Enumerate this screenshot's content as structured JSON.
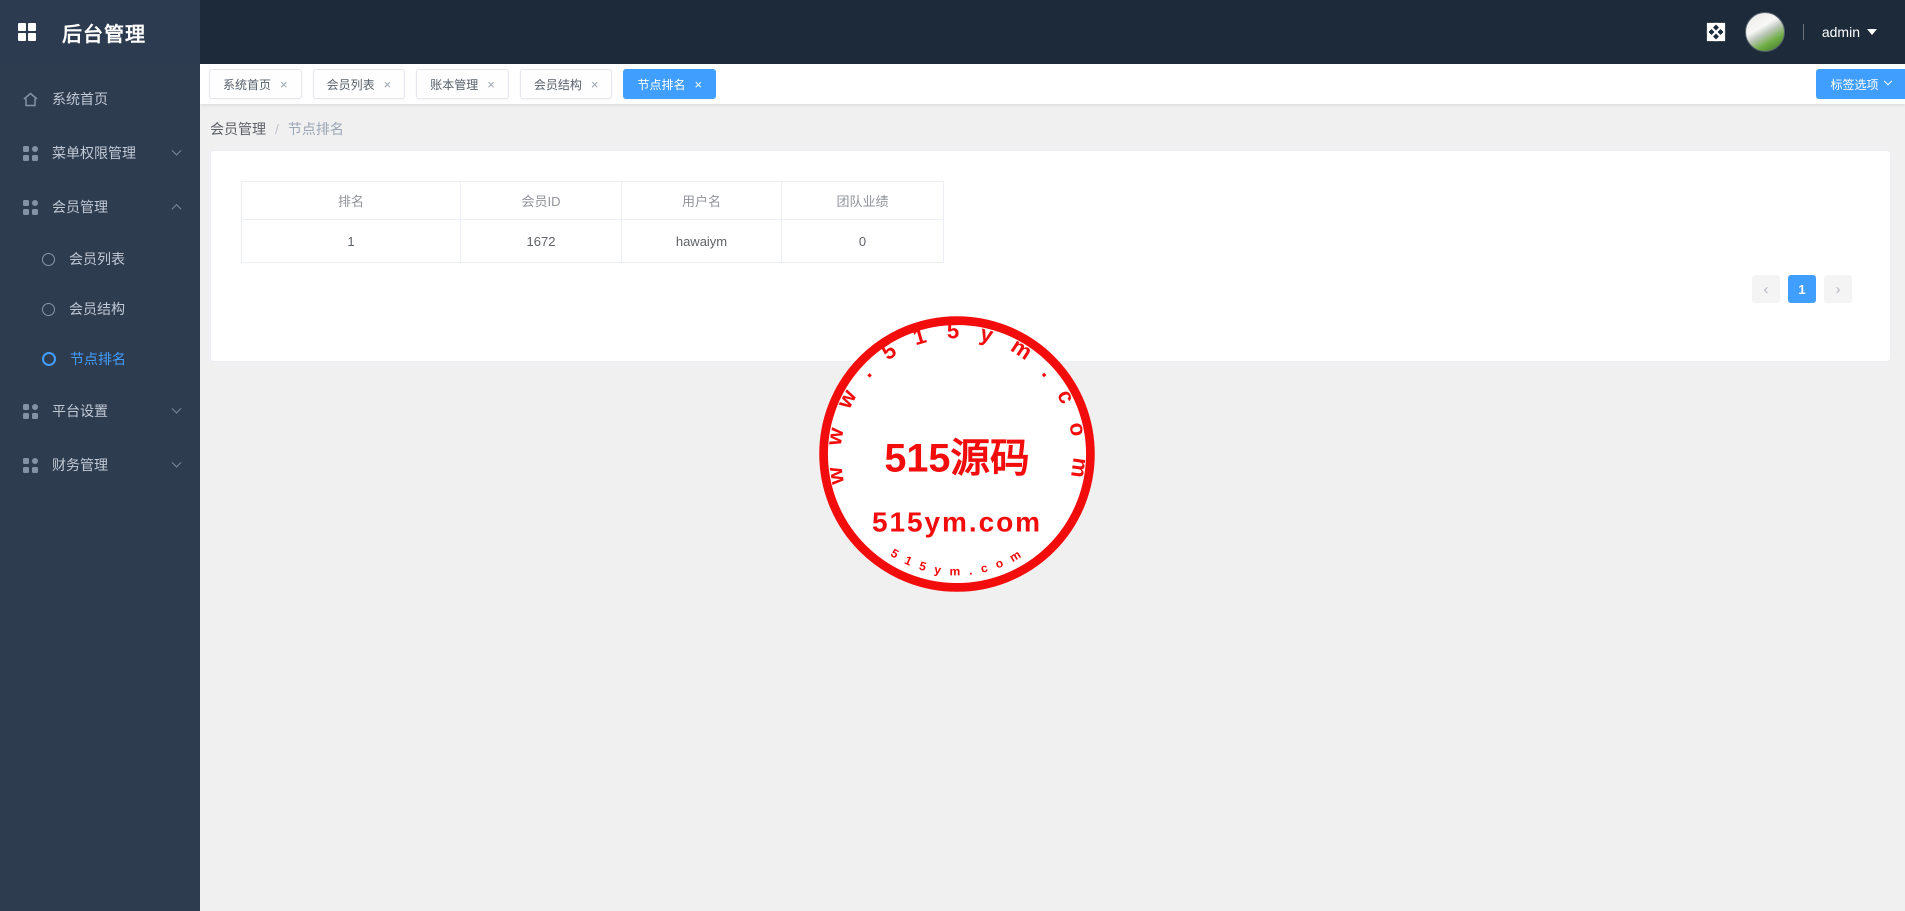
{
  "header": {
    "logo_title": "后台管理",
    "username": "admin"
  },
  "sidebar": {
    "items": [
      {
        "label": "系统首页",
        "icon": "home-icon"
      },
      {
        "label": "菜单权限管理",
        "icon": "grid-icon",
        "chevron": "down"
      },
      {
        "label": "会员管理",
        "icon": "grid-icon",
        "chevron": "up",
        "expanded": true,
        "children": [
          {
            "label": "会员列表",
            "active": false
          },
          {
            "label": "会员结构",
            "active": false
          },
          {
            "label": "节点排名",
            "active": true
          }
        ]
      },
      {
        "label": "平台设置",
        "icon": "grid-icon",
        "chevron": "down"
      },
      {
        "label": "财务管理",
        "icon": "grid-icon",
        "chevron": "down"
      }
    ]
  },
  "tabs": {
    "close_glyph": "×",
    "items": [
      {
        "label": "系统首页",
        "active": false
      },
      {
        "label": "会员列表",
        "active": false
      },
      {
        "label": "账本管理",
        "active": false
      },
      {
        "label": "会员结构",
        "active": false
      },
      {
        "label": "节点排名",
        "active": true
      }
    ],
    "options_label": "标签选项"
  },
  "breadcrumb": {
    "section": "会员管理",
    "separator": "/",
    "page": "节点排名"
  },
  "table": {
    "headers": [
      "排名",
      "会员ID",
      "用户名",
      "团队业绩"
    ],
    "rows": [
      [
        "1",
        "1672",
        "hawaiym",
        "0"
      ]
    ]
  },
  "pagination": {
    "prev": "‹",
    "page": "1",
    "next": "›"
  },
  "watermark": {
    "arc_top": "w w w . 5 1 5 y m . c o m",
    "title": "515源码",
    "subtitle": "515ym.com",
    "arc_bottom": "5 1 5 y m . c o m",
    "color": "#f20c0c"
  },
  "colors": {
    "accent": "#409EFF",
    "header_bg": "#1c2a3a",
    "sidebar_bg": "#2e3c50",
    "content_bg": "#f0f0f0"
  }
}
